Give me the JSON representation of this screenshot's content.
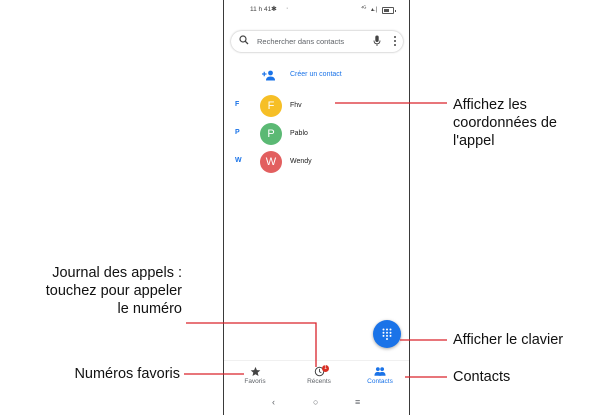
{
  "status_bar": {
    "time": "11 h 41",
    "network_text": "⁴ᴳ",
    "signal_text": "▴.|"
  },
  "search": {
    "placeholder": "Rechercher dans contacts"
  },
  "create_contact": {
    "label": "Créer un contact"
  },
  "contacts": [
    {
      "letter": "F",
      "initial": "F",
      "name": "Fhv",
      "color": "#f6bf26"
    },
    {
      "letter": "P",
      "initial": "P",
      "name": "Pablo",
      "color": "#5bb974"
    },
    {
      "letter": "W",
      "initial": "W",
      "name": "Wendy",
      "color": "#e25f5f"
    }
  ],
  "bottom_nav": {
    "favorites": "Favoris",
    "recents": "Récents",
    "recents_badge": "1",
    "contacts": "Contacts"
  },
  "system_nav": {
    "back": "‹",
    "home": "○",
    "menu": "≡"
  },
  "annotations": {
    "details_line1": "Affichez les",
    "details_line2": "coordonnées de",
    "details_line3": "l'appel",
    "log_line1": "Journal des appels :",
    "log_line2": "touchez pour appeler",
    "log_line3": "le numéro",
    "dialpad": "Afficher le clavier",
    "favorites": "Numéros favoris",
    "contacts": "Contacts"
  },
  "colors": {
    "accent": "#1a73e8",
    "badge": "#d93025",
    "callout_line": "#d9232b"
  }
}
